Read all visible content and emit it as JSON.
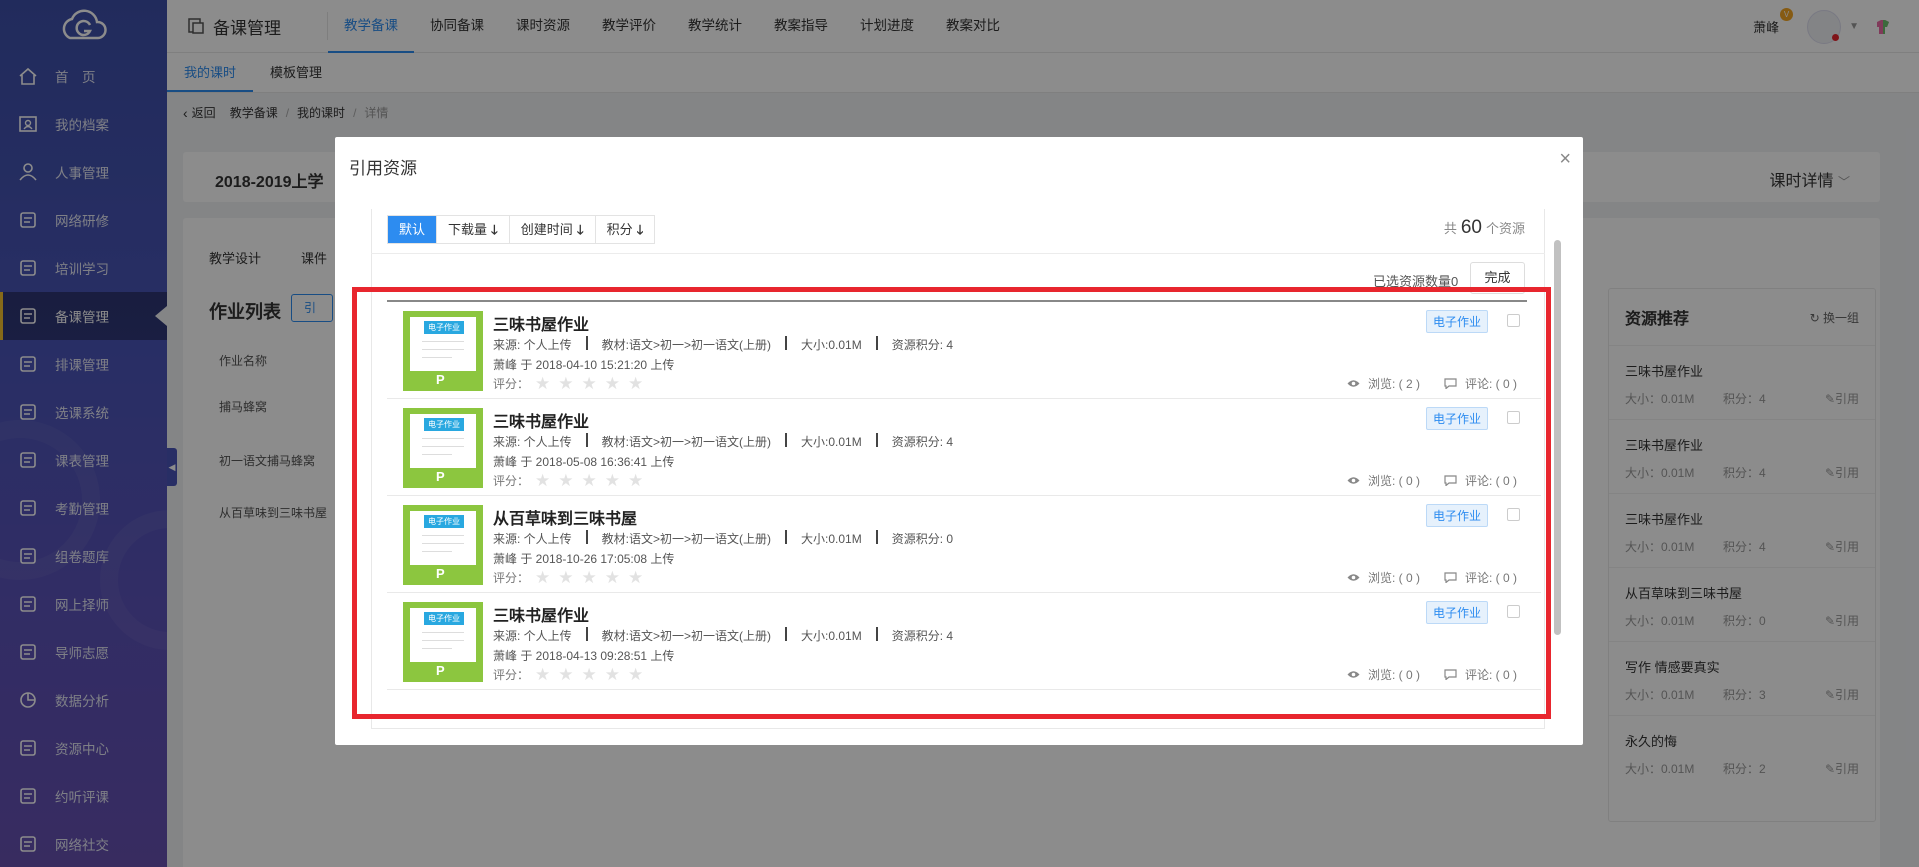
{
  "sidebar": {
    "items": [
      {
        "label": "首　页",
        "icon": "home-icon"
      },
      {
        "label": "我的档案",
        "icon": "profile-icon"
      },
      {
        "label": "人事管理",
        "icon": "person-icon"
      },
      {
        "label": "网络研修",
        "icon": "network-study-icon"
      },
      {
        "label": "培训学习",
        "icon": "training-icon"
      },
      {
        "label": "备课管理",
        "icon": "lesson-prep-icon",
        "active": true
      },
      {
        "label": "排课管理",
        "icon": "schedule-icon"
      },
      {
        "label": "选课系统",
        "icon": "course-select-icon"
      },
      {
        "label": "课表管理",
        "icon": "timetable-icon"
      },
      {
        "label": "考勤管理",
        "icon": "attendance-icon"
      },
      {
        "label": "组卷题库",
        "icon": "question-bank-icon"
      },
      {
        "label": "网上择师",
        "icon": "teacher-select-icon"
      },
      {
        "label": "导师志愿",
        "icon": "mentor-icon"
      },
      {
        "label": "数据分析",
        "icon": "pie-chart-icon"
      },
      {
        "label": "资源中心",
        "icon": "resource-icon"
      },
      {
        "label": "约听评课",
        "icon": "listen-icon"
      },
      {
        "label": "网络社交",
        "icon": "social-icon"
      }
    ]
  },
  "topbar": {
    "module_title": "备课管理",
    "nav": [
      "教学备课",
      "协同备课",
      "课时资源",
      "教学评价",
      "教学统计",
      "教案指导",
      "计划进度",
      "教案对比"
    ],
    "user_name": "萧峰",
    "user_badge": "V"
  },
  "subnav": [
    "我的课时",
    "模板管理"
  ],
  "breadcrumb": {
    "back": "返回",
    "items": [
      "教学备课",
      "我的课时"
    ],
    "current": "详情"
  },
  "background": {
    "term_title": "2018-2019上学",
    "detail_label": "课时详情",
    "tabs": [
      "教学设计",
      "课件"
    ],
    "list_title": "作业列表",
    "cite_button": "引用",
    "col_header": "作业名称",
    "rows": [
      "捕马蜂窝",
      "初一语文捕马蜂窝",
      "从百草味到三味书屋"
    ]
  },
  "recommend": {
    "title": "资源推荐",
    "switch_label": "换一组",
    "cite_label": "✎引用",
    "items": [
      {
        "name": "三味书屋作业",
        "size": "大小：0.01M",
        "points": "积分：4"
      },
      {
        "name": "三味书屋作业",
        "size": "大小：0.01M",
        "points": "积分：4"
      },
      {
        "name": "三味书屋作业",
        "size": "大小：0.01M",
        "points": "积分：4"
      },
      {
        "name": "从百草味到三味书屋",
        "size": "大小：0.01M",
        "points": "积分：0"
      },
      {
        "name": "写作 情感要真实",
        "size": "大小：0.01M",
        "points": "积分：3"
      },
      {
        "name": "永久的悔",
        "size": "大小：0.01M",
        "points": "积分：2"
      }
    ]
  },
  "modal": {
    "title": "引用资源",
    "close": "×",
    "sort": [
      "默认",
      "下载量",
      "创建时间",
      "积分"
    ],
    "total_prefix": "共",
    "total_count": "60",
    "total_suffix": "个资源",
    "selected_label": "已选资源数量0",
    "done_label": "完成",
    "resources": [
      {
        "title": "三味书屋作业",
        "source": "来源:  个人上传",
        "material": "教材:语文>初一>初一语文(上册)",
        "size": "大小:0.01M",
        "points": "资源积分: 4",
        "upload": "萧峰 于 2018-04-10 15:21:20 上传",
        "rating_label": "评分：",
        "type": "电子作业",
        "views": "浏览: ( 2 )",
        "comments": "评论: ( 0 )",
        "thumb_tag": "电子作业",
        "thumb_mark": "P"
      },
      {
        "title": "三味书屋作业",
        "source": "来源:  个人上传",
        "material": "教材:语文>初一>初一语文(上册)",
        "size": "大小:0.01M",
        "points": "资源积分: 4",
        "upload": "萧峰 于 2018-05-08 16:36:41 上传",
        "rating_label": "评分：",
        "type": "电子作业",
        "views": "浏览: ( 0 )",
        "comments": "评论: ( 0 )",
        "thumb_tag": "电子作业",
        "thumb_mark": "P"
      },
      {
        "title": "从百草味到三味书屋",
        "source": "来源:  个人上传",
        "material": "教材:语文>初一>初一语文(上册)",
        "size": "大小:0.01M",
        "points": "资源积分: 0",
        "upload": "萧峰 于 2018-10-26 17:05:08 上传",
        "rating_label": "评分：",
        "type": "电子作业",
        "views": "浏览: ( 0 )",
        "comments": "评论: ( 0 )",
        "thumb_tag": "电子作业",
        "thumb_mark": "P"
      },
      {
        "title": "三味书屋作业",
        "source": "来源:  个人上传",
        "material": "教材:语文>初一>初一语文(上册)",
        "size": "大小:0.01M",
        "points": "资源积分: 4",
        "upload": "萧峰 于 2018-04-13 09:28:51 上传",
        "rating_label": "评分：",
        "type": "电子作业",
        "views": "浏览: ( 0 )",
        "comments": "评论: ( 0 )",
        "thumb_tag": "电子作业",
        "thumb_mark": "P"
      }
    ]
  },
  "colors": {
    "accent": "#2d8cf0",
    "highlight_box": "#e8262e",
    "thumb_green": "#8cc63f",
    "sidebar_active_bar": "#f5c12e"
  }
}
